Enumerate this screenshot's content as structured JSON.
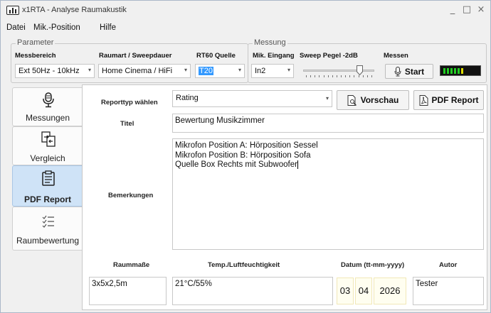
{
  "window": {
    "title": "x1RTA - Analyse Raumakustik",
    "minimize_glyph": "_",
    "maximize_glyph": "□",
    "close_glyph": "×"
  },
  "menu": {
    "items": [
      "Datei",
      "Mik.-Position",
      "Hilfe"
    ]
  },
  "parameter_group": {
    "legend": "Parameter",
    "messbereich_label": "Messbereich",
    "messbereich_value": "Ext 50Hz - 10kHz",
    "raumart_label": "Raumart / Sweepdauer",
    "raumart_value": "Home Cinema / HiFi",
    "rt60_label": "RT60 Quelle",
    "rt60_value": "T20"
  },
  "messung_group": {
    "legend": "Messung",
    "mik_eingang_label": "Mik. Eingang",
    "mik_eingang_value": "In2",
    "sweep_label": "Sweep Pegel -2dB",
    "sweep_level": 0.82,
    "messen_label": "Messen",
    "start_label": "Start"
  },
  "sidebar": {
    "tabs": [
      {
        "label": "Messungen",
        "icon": "microphone-icon",
        "active": false
      },
      {
        "label": "Vergleich",
        "icon": "compare-documents-icon",
        "active": false
      },
      {
        "label": "PDF Report",
        "icon": "clipboard-icon",
        "active": true
      },
      {
        "label": "Raumbewertung",
        "icon": "checklist-icon",
        "active": false
      }
    ]
  },
  "report": {
    "reporttyp_label": "Reporttyp wählen",
    "reporttyp_value": "Rating",
    "vorschau_label": "Vorschau",
    "pdf_report_label": "PDF Report",
    "titel_label": "Titel",
    "titel_value": "Bewertung Musikzimmer",
    "bemerkungen_label": "Bemerkungen",
    "bemerkungen_lines": [
      "Mikrofon Position A: Hörposition Sessel",
      "Mikrofon Position B: Hörposition Sofa",
      "Quelle Box Rechts mit Subwoofer"
    ],
    "raummasse_label": "Raummaße",
    "raummasse_value": "3x5x2,5m",
    "temp_label": "Temp./Luftfeuchtigkeit",
    "temp_value": "21°C/55%",
    "datum_label": "Datum (tt-mm-yyyy)",
    "datum_day": "03",
    "datum_month": "04",
    "datum_year": "2026",
    "autor_label": "Autor",
    "autor_value": "Tester"
  },
  "colors": {
    "active_tab": "#cfe3f7",
    "selection": "#3399ff",
    "meter_green": "#22cc22",
    "meter_yellow": "#dddd00",
    "date_bg": "#fffef0"
  }
}
